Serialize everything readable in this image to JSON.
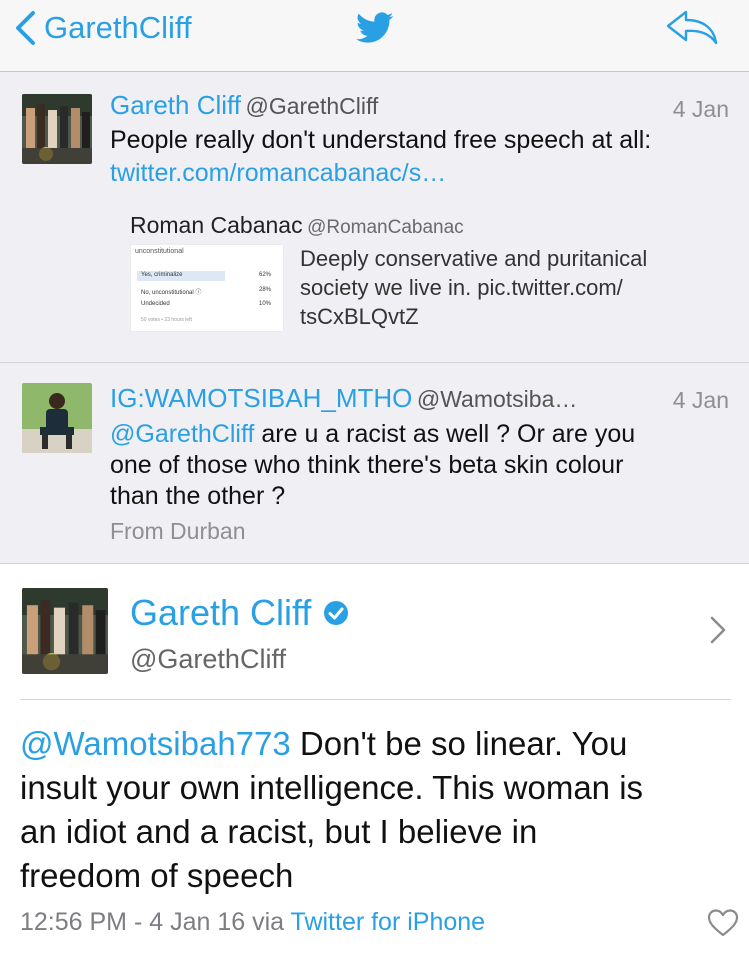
{
  "nav": {
    "back_label": "GarethCliff",
    "bird_icon": "twitter-bird-icon",
    "reply_icon": "reply-arrow-icon",
    "accent": "#2aa0e4"
  },
  "context_tweets": [
    {
      "name": "Gareth Cliff",
      "handle": "@GarethCliff",
      "date": "4 Jan",
      "text": "People really don't understand free speech at all:",
      "link": "twitter.com/romancabanac/s…",
      "quote": {
        "name": "Roman Cabanac",
        "handle": "@RomanCabanac",
        "text_lines": [
          "Deeply conservative and puritanical",
          "society we live in. pic.twitter.com/",
          "tsCxBLQvtZ"
        ],
        "poll": {
          "title": "unconstitutional",
          "options": [
            {
              "label": "Yes, criminalize",
              "pct": "62%",
              "value": 0.62
            },
            {
              "label": "No, unconstitutional ⓘ",
              "pct": "28%",
              "value": 0.28
            },
            {
              "label": "Undecided",
              "pct": "10%",
              "value": 0.1
            }
          ],
          "footer": "50 votes • 23 hours left"
        }
      }
    },
    {
      "name": "IG:WAMOTSIBAH_MTHO",
      "handle": "@Wamotsiba…",
      "date": "4 Jan",
      "mention": "@GarethCliff",
      "text_lines": [
        " are u a racist as well ? Or are you",
        "one of those who think there's beta skin colour",
        "than the other ?"
      ],
      "location": "From Durban"
    }
  ],
  "main_tweet": {
    "name": "Gareth Cliff",
    "verified_icon": "verified-badge-icon",
    "handle": "@GarethCliff",
    "mention": "@Wamotsibah773",
    "text_lines": [
      " Don't be so linear. You",
      "insult your own intelligence. This woman is",
      "an idiot and a racist, but I believe in",
      "freedom of speech"
    ],
    "time": "12:56 PM - 4 Jan 16 via ",
    "source": "Twitter for iPhone",
    "like_icon": "heart-icon"
  }
}
